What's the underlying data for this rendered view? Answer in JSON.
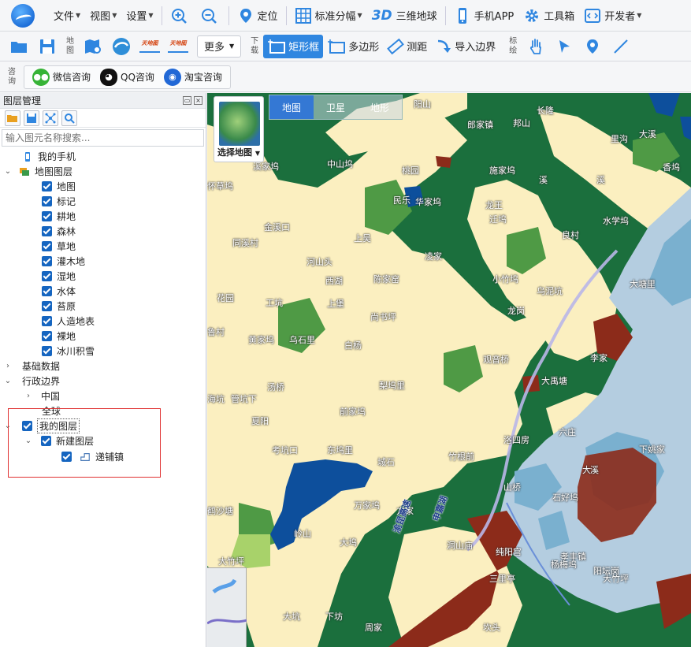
{
  "menubar": {
    "items": [
      {
        "label": "文件",
        "has_caret": true
      },
      {
        "label": "视图",
        "has_caret": true
      },
      {
        "label": "设置",
        "has_caret": true
      }
    ],
    "locate_label": "定位",
    "grid_label": "标准分幅",
    "globe_label": "三维地球",
    "globe_prefix": "3D",
    "app_label": "手机APP",
    "toolbox_label": "工具箱",
    "developer_label": "开发者"
  },
  "toolbar2": {
    "map_group_label": "地图",
    "more_label": "更多",
    "download_group_label": "下载",
    "rect_label": "矩形框",
    "polygon_label": "多边形",
    "measure_label": "测距",
    "import_label": "导入边界",
    "draw_group_label": "标绘",
    "logo_text": "天地图"
  },
  "toolbar3": {
    "group_label": "咨询",
    "wechat_label": "微信咨询",
    "qq_label": "QQ咨询",
    "taobao_label": "淘宝咨询"
  },
  "panel": {
    "title": "图层管理",
    "search_placeholder": "输入图元名称搜索...",
    "tree": {
      "my_phone": "我的手机",
      "map_layers": "地图图层",
      "layers": [
        "地图",
        "标记",
        "耕地",
        "森林",
        "草地",
        "灌木地",
        "湿地",
        "水体",
        "苔原",
        "人造地表",
        "裸地",
        "冰川积雪"
      ],
      "base_data": "基础数据",
      "admin_boundary": "行政边界",
      "china": "中国",
      "global": "全球",
      "my_layers": "我的图层",
      "new_layer": "新建图层",
      "feature": "递铺镇"
    }
  },
  "map": {
    "tabs": [
      {
        "label": "地图",
        "active": true
      },
      {
        "label": "卫星",
        "active": false
      },
      {
        "label": "地形",
        "active": false
      }
    ],
    "chooser_label": "选择地图",
    "labels": [
      {
        "text": "阳山",
        "dark": false
      },
      {
        "text": "郎家镇",
        "dark": false
      },
      {
        "text": "邦山",
        "dark": false
      },
      {
        "text": "长隆",
        "dark": false
      },
      {
        "text": "里沟",
        "dark": false
      },
      {
        "text": "大溪",
        "dark": false
      },
      {
        "text": "香坞",
        "dark": false
      },
      {
        "text": "溪家坞",
        "dark": false
      },
      {
        "text": "中山坞",
        "dark": false
      },
      {
        "text": "怀草坞",
        "dark": false
      },
      {
        "text": "桃园",
        "dark": false
      },
      {
        "text": "施家坞",
        "dark": false
      },
      {
        "text": "溪",
        "dark": false
      },
      {
        "text": "溪",
        "dark": false
      },
      {
        "text": "民乐",
        "dark": false
      },
      {
        "text": "华家坞",
        "dark": false
      },
      {
        "text": "龙王",
        "dark": false
      },
      {
        "text": "迁坞",
        "dark": false
      },
      {
        "text": "良村",
        "dark": false
      },
      {
        "text": "水学坞",
        "dark": false
      },
      {
        "text": "金溪口",
        "dark": false
      },
      {
        "text": "同溪村",
        "dark": false
      },
      {
        "text": "上吴",
        "dark": false
      },
      {
        "text": "河山头",
        "dark": false
      },
      {
        "text": "凌家",
        "dark": false
      },
      {
        "text": "西湖",
        "dark": false
      },
      {
        "text": "陈家窑",
        "dark": false
      },
      {
        "text": "小竹坞",
        "dark": false
      },
      {
        "text": "乌泥坑",
        "dark": false
      },
      {
        "text": "大塘里",
        "dark": false
      },
      {
        "text": "花园",
        "dark": false
      },
      {
        "text": "工坑",
        "dark": false
      },
      {
        "text": "上堡",
        "dark": false
      },
      {
        "text": "尚书坪",
        "dark": false
      },
      {
        "text": "龙岗",
        "dark": false
      },
      {
        "text": "鲁村",
        "dark": false
      },
      {
        "text": "黄家坞",
        "dark": false
      },
      {
        "text": "乌石里",
        "dark": false
      },
      {
        "text": "白杨",
        "dark": false
      },
      {
        "text": "观音桥",
        "dark": false
      },
      {
        "text": "李家",
        "dark": false
      },
      {
        "text": "汤桥",
        "dark": false
      },
      {
        "text": "梨坞里",
        "dark": false
      },
      {
        "text": "大禹塘",
        "dark": false
      },
      {
        "text": "海坑",
        "dark": false
      },
      {
        "text": "管坑下",
        "dark": false
      },
      {
        "text": "前家坞",
        "dark": false
      },
      {
        "text": "夏阳",
        "dark": false
      },
      {
        "text": "洛四房",
        "dark": false
      },
      {
        "text": "六庄",
        "dark": false
      },
      {
        "text": "下姚家",
        "dark": false
      },
      {
        "text": "考坑口",
        "dark": false
      },
      {
        "text": "东坞里",
        "dark": false
      },
      {
        "text": "竹根前",
        "dark": false
      },
      {
        "text": "城石",
        "dark": false
      },
      {
        "text": "大",
        "dark": false
      },
      {
        "text": "山桥",
        "dark": false
      },
      {
        "text": "石好坞",
        "dark": false
      },
      {
        "text": "溪",
        "dark": false
      },
      {
        "text": "万家坞",
        "dark": false
      },
      {
        "text": "方家",
        "dark": false
      },
      {
        "text": "鹤沙塘",
        "dark": false
      },
      {
        "text": "申嘉湖",
        "dark": true
      },
      {
        "text": "渝昆高速",
        "dark": true
      },
      {
        "text": "岭山",
        "dark": false
      },
      {
        "text": "大坞",
        "dark": false
      },
      {
        "text": "洞山庙",
        "dark": false
      },
      {
        "text": "纯阳宫",
        "dark": false
      },
      {
        "text": "孝丰镇",
        "dark": false
      },
      {
        "text": "杨梅坞",
        "dark": false
      },
      {
        "text": "阳坛岗",
        "dark": false
      },
      {
        "text": "大竹坪",
        "dark": false
      },
      {
        "text": "三里亭",
        "dark": false
      },
      {
        "text": "大竹坪",
        "dark": false
      },
      {
        "text": "大坑",
        "dark": false
      },
      {
        "text": "下坊",
        "dark": false
      },
      {
        "text": "周家",
        "dark": false
      },
      {
        "text": "坎头",
        "dark": false
      }
    ]
  },
  "colors": {
    "forest": "#1b6f3d",
    "grass": "#fbefc0",
    "shrub": "#4f9a45",
    "water": "#0d4f9c",
    "urban": "#8c2b1a",
    "cropland": "#b4cde0",
    "wetland": "#7ab0cf",
    "accent": "#2f86e0",
    "checkbox": "#1565c0",
    "highlight_border": "#e03131"
  }
}
